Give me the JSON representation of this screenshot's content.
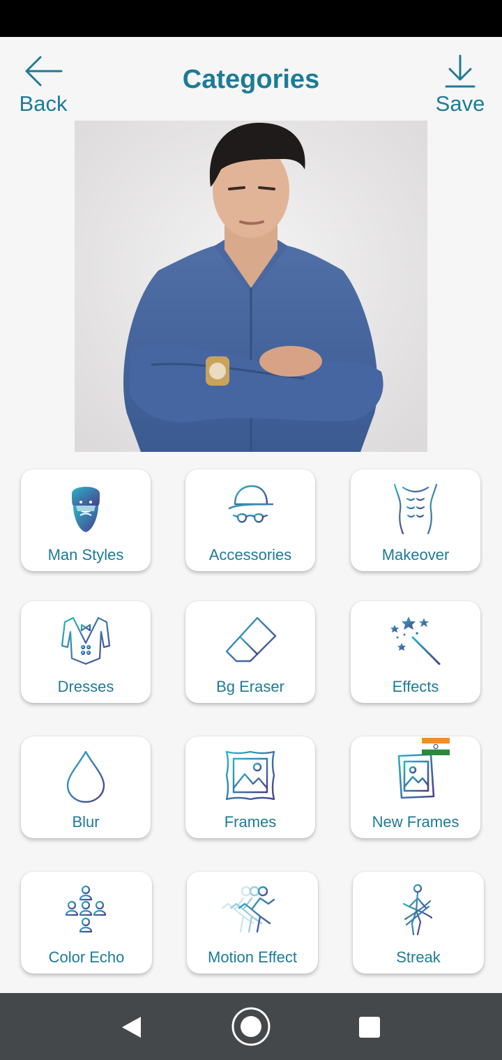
{
  "header": {
    "title": "Categories",
    "back_label": "Back",
    "save_label": "Save",
    "back_icon": "arrow-left-icon",
    "save_icon": "download-icon"
  },
  "photo": {
    "icon": "portrait-photo"
  },
  "categories": [
    {
      "label": "Man Styles",
      "icon": "bearded-man-icon"
    },
    {
      "label": "Accessories",
      "icon": "cap-glasses-icon"
    },
    {
      "label": "Makeover",
      "icon": "abs-torso-icon"
    },
    {
      "label": "Dresses",
      "icon": "vest-icon"
    },
    {
      "label": "Bg Eraser",
      "icon": "eraser-icon"
    },
    {
      "label": "Effects",
      "icon": "magic-wand-icon"
    },
    {
      "label": "Blur",
      "icon": "drop-icon"
    },
    {
      "label": "Frames",
      "icon": "picture-frame-icon"
    },
    {
      "label": "New Frames",
      "icon": "new-frame-icon"
    },
    {
      "label": "Color Echo",
      "icon": "people-group-icon"
    },
    {
      "label": "Motion Effect",
      "icon": "running-man-icon"
    },
    {
      "label": "Streak",
      "icon": "streak-figure-icon"
    }
  ],
  "nav": {
    "back_icon": "triangle-back-icon",
    "home_icon": "circle-home-icon",
    "recents_icon": "square-recents-icon"
  },
  "colors": {
    "accent": "#1d7b97",
    "icon_start": "#2bb3c6",
    "icon_end": "#4a3f8f",
    "nav_bg": "#45484b"
  }
}
